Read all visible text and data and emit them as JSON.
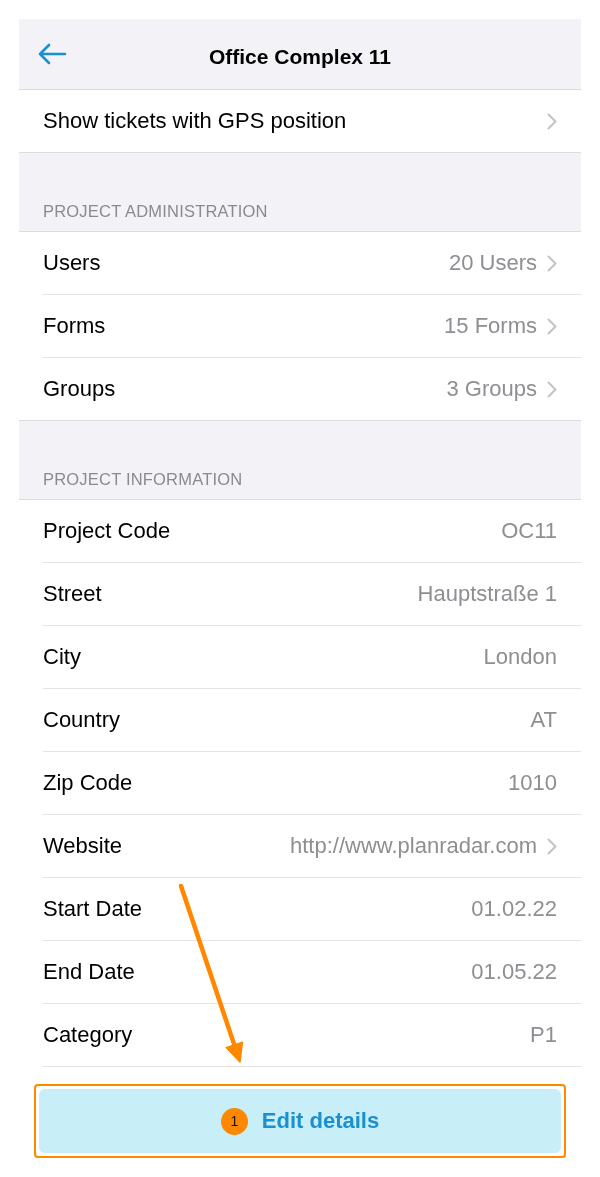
{
  "header": {
    "title": "Office Complex 11"
  },
  "top_row": {
    "label": "Show tickets with GPS position",
    "chevron": true
  },
  "sections": [
    {
      "title": "PROJECT ADMINISTRATION",
      "rows": [
        {
          "label": "Users",
          "value": "20 Users",
          "chevron": true
        },
        {
          "label": "Forms",
          "value": "15 Forms",
          "chevron": true
        },
        {
          "label": "Groups",
          "value": "3 Groups",
          "chevron": true
        }
      ]
    },
    {
      "title": "PROJECT INFORMATION",
      "rows": [
        {
          "label": "Project Code",
          "value": "OC11",
          "chevron": false
        },
        {
          "label": "Street",
          "value": "Hauptstraße 1",
          "chevron": false
        },
        {
          "label": "City",
          "value": "London",
          "chevron": false
        },
        {
          "label": "Country",
          "value": "AT",
          "chevron": false
        },
        {
          "label": "Zip Code",
          "value": "1010",
          "chevron": false
        },
        {
          "label": "Website",
          "value": "http://www.planradar.com",
          "chevron": true
        },
        {
          "label": "Start Date",
          "value": "01.02.22",
          "chevron": false
        },
        {
          "label": "End Date",
          "value": "01.05.22",
          "chevron": false
        },
        {
          "label": "Category",
          "value": "P1",
          "chevron": false
        }
      ]
    }
  ],
  "edit_button": {
    "label": "Edit details",
    "badge": "1",
    "highlighted": true
  }
}
